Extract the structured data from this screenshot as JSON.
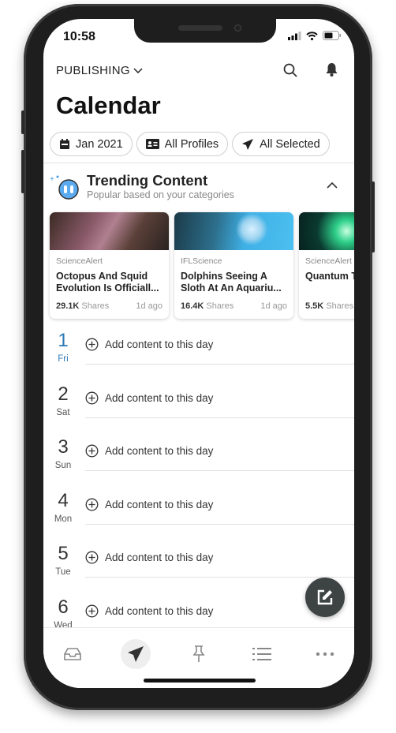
{
  "status_bar": {
    "time": "10:58"
  },
  "header": {
    "section": "PUBLISHING",
    "title": "Calendar"
  },
  "filters": [
    {
      "label": "Jan 2021",
      "icon": "calendar-icon"
    },
    {
      "label": "All Profiles",
      "icon": "id-card-icon"
    },
    {
      "label": "All Selected",
      "icon": "paper-plane-icon"
    }
  ],
  "trending": {
    "title": "Trending Content",
    "subtitle": "Popular based on your categories",
    "cards": [
      {
        "source": "ScienceAlert",
        "headline": "Octopus And Squid Evolution Is Officiall...",
        "shares": "29.1K",
        "shares_label": "Shares",
        "age": "1d ago"
      },
      {
        "source": "IFLScience",
        "headline": "Dolphins Seeing A Sloth At An Aquariu...",
        "shares": "16.4K",
        "shares_label": "Shares",
        "age": "1d ago"
      },
      {
        "source": "ScienceAlert",
        "headline": "Quantum Teleportat",
        "shares": "5.5K",
        "shares_label": "Shares",
        "age": ""
      }
    ]
  },
  "days": [
    {
      "num": "1",
      "name": "Fri",
      "action": "Add content to this day"
    },
    {
      "num": "2",
      "name": "Sat",
      "action": "Add content to this day"
    },
    {
      "num": "3",
      "name": "Sun",
      "action": "Add content to this day"
    },
    {
      "num": "4",
      "name": "Mon",
      "action": "Add content to this day"
    },
    {
      "num": "5",
      "name": "Tue",
      "action": "Add content to this day"
    },
    {
      "num": "6",
      "name": "Wed",
      "action": "Add content to this day"
    }
  ],
  "colors": {
    "today": "#2b78b5",
    "fab": "#3e4444"
  },
  "tabs": [
    "inbox-icon",
    "publish-icon",
    "pin-icon",
    "list-icon",
    "more-icon"
  ]
}
